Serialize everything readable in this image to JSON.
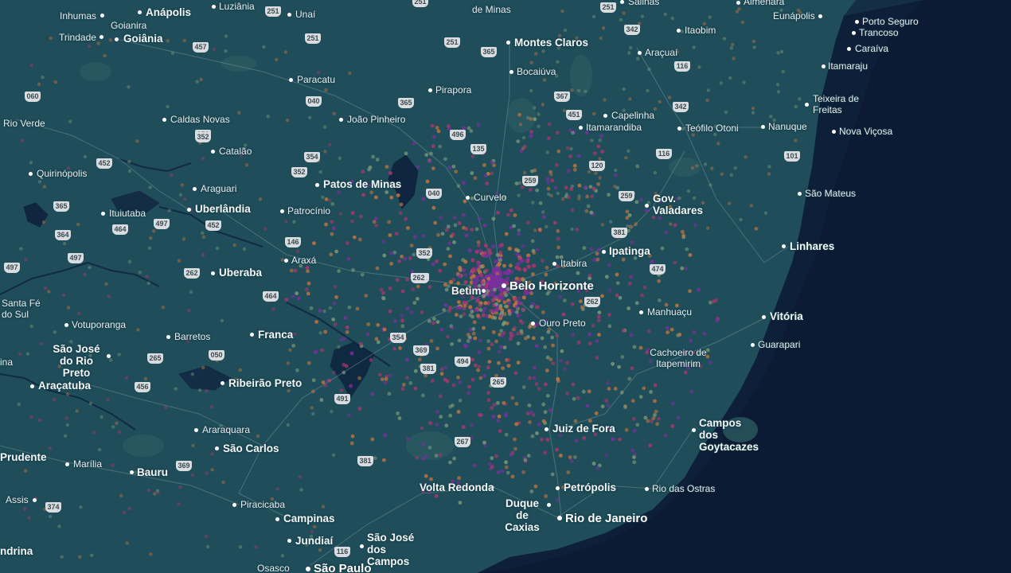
{
  "map": {
    "colors": {
      "land": "#1f4e5a",
      "ocean": "#0c1a33",
      "water_bodies": "#0f2540",
      "road": "#6f8d95",
      "point_purple": "#7a2f9e",
      "point_magenta": "#b0356e",
      "point_orange": "#c6763e",
      "point_sage": "#7f9a7a"
    },
    "cities": [
      {
        "id": "belo-horizonte",
        "name": "Belo Horizonte",
        "size": "mega"
      },
      {
        "id": "rio-de-janeiro",
        "name": "Rio de Janeiro",
        "size": "mega"
      },
      {
        "id": "sao-paulo",
        "name": "São Paulo",
        "size": "mega"
      },
      {
        "id": "goiania",
        "name": "Goiânia",
        "size": "major"
      },
      {
        "id": "anapolis",
        "name": "Anápolis",
        "size": "major"
      },
      {
        "id": "campinas",
        "name": "Campinas",
        "size": "major"
      },
      {
        "id": "uberlandia",
        "name": "Uberlândia",
        "size": "major"
      },
      {
        "id": "uberaba",
        "name": "Uberaba",
        "size": "major"
      },
      {
        "id": "montes-claros",
        "name": "Montes Claros",
        "size": "major"
      },
      {
        "id": "juiz-de-fora",
        "name": "Juiz de Fora",
        "size": "major"
      },
      {
        "id": "vitoria",
        "name": "Vitória",
        "size": "major"
      },
      {
        "id": "ipatinga",
        "name": "Ipatinga",
        "size": "major"
      },
      {
        "id": "gov-valadares",
        "name": "Gov. Valadares",
        "size": "major"
      },
      {
        "id": "patos-de-minas",
        "name": "Patos de Minas",
        "size": "major"
      },
      {
        "id": "ribeirao-preto",
        "name": "Ribeirão Preto",
        "size": "major"
      },
      {
        "id": "franca",
        "name": "Franca",
        "size": "major"
      },
      {
        "id": "bauru",
        "name": "Bauru",
        "size": "major"
      },
      {
        "id": "sao-carlos",
        "name": "São Carlos",
        "size": "major"
      },
      {
        "id": "petropolis",
        "name": "Petrópolis",
        "size": "major"
      },
      {
        "id": "volta-redonda",
        "name": "Volta Redonda",
        "size": "major"
      },
      {
        "id": "duque-de-caxias",
        "name": "Duque de Caxias",
        "size": "major"
      },
      {
        "id": "campos-dos-goytacazes",
        "name": "Campos dos Goytacazes",
        "size": "major"
      },
      {
        "id": "sao-jose-dos-campos",
        "name": "São José dos Campos",
        "size": "major"
      },
      {
        "id": "jundiai",
        "name": "Jundiaí",
        "size": "major"
      },
      {
        "id": "linhares",
        "name": "Linhares",
        "size": "major"
      },
      {
        "id": "betim",
        "name": "Betim",
        "size": "major"
      },
      {
        "id": "sao-jose-do-rio-preto",
        "name": "São José do Rio Preto",
        "size": "major"
      },
      {
        "id": "aracatuba",
        "name": "Araçatuba",
        "size": "major"
      },
      {
        "id": "presidente-prudente",
        "name": "Prudente",
        "size": "major"
      },
      {
        "id": "santa-fe-do-sul",
        "name": "Santa Fé do Sul",
        "size": "minor"
      },
      {
        "id": "inhumas",
        "name": "Inhumas",
        "size": "minor"
      },
      {
        "id": "goianira",
        "name": "Goianira",
        "size": "minor"
      },
      {
        "id": "trindade",
        "name": "Trindade",
        "size": "minor"
      },
      {
        "id": "luziania",
        "name": "Luziânia",
        "size": "minor"
      },
      {
        "id": "unai",
        "name": "Unaí",
        "size": "minor"
      },
      {
        "id": "paracatu",
        "name": "Paracatu",
        "size": "minor"
      },
      {
        "id": "joao-pinheiro",
        "name": "João Pinheiro",
        "size": "minor"
      },
      {
        "id": "rio-verde",
        "name": "Rio Verde",
        "size": "minor"
      },
      {
        "id": "caldas-novas",
        "name": "Caldas Novas",
        "size": "minor"
      },
      {
        "id": "catalao",
        "name": "Catalão",
        "size": "minor"
      },
      {
        "id": "quirinopolis",
        "name": "Quirinópolis",
        "size": "minor"
      },
      {
        "id": "araguari",
        "name": "Araguari",
        "size": "minor"
      },
      {
        "id": "ituiutaba",
        "name": "Ituiutaba",
        "size": "minor"
      },
      {
        "id": "patrocinio",
        "name": "Patrocínio",
        "size": "minor"
      },
      {
        "id": "araxa",
        "name": "Araxá",
        "size": "minor"
      },
      {
        "id": "votuporanga",
        "name": "Votuporanga",
        "size": "minor"
      },
      {
        "id": "barretos",
        "name": "Barretos",
        "size": "minor"
      },
      {
        "id": "araraquara",
        "name": "Araraquara",
        "size": "minor"
      },
      {
        "id": "marilia",
        "name": "Marília",
        "size": "minor"
      },
      {
        "id": "assis",
        "name": "Assis",
        "size": "minor"
      },
      {
        "id": "piracicaba",
        "name": "Piracicaba",
        "size": "minor"
      },
      {
        "id": "osasco",
        "name": "Osasco",
        "size": "minor"
      },
      {
        "id": "andradina",
        "name": "ndrina",
        "size": "minor"
      },
      {
        "id": "ilha-solteira",
        "name": "ina",
        "size": "minor"
      },
      {
        "id": "pirapora",
        "name": "Pirapora",
        "size": "minor"
      },
      {
        "id": "bocaiuva",
        "name": "Bocaiúva",
        "size": "minor"
      },
      {
        "id": "curvelo",
        "name": "Curvelo",
        "size": "minor"
      },
      {
        "id": "itabira",
        "name": "Itabira",
        "size": "minor"
      },
      {
        "id": "ouro-preto",
        "name": "Ouro Preto",
        "size": "minor"
      },
      {
        "id": "manhuacu",
        "name": "Manhuaçu",
        "size": "minor"
      },
      {
        "id": "cachoeiro-de-itapemirim",
        "name": "Cachoeiro de Itapemirim",
        "size": "minor"
      },
      {
        "id": "guarapari",
        "name": "Guarapari",
        "size": "minor"
      },
      {
        "id": "sao-mateus",
        "name": "São Mateus",
        "size": "minor"
      },
      {
        "id": "nanuque",
        "name": "Nanuque",
        "size": "minor"
      },
      {
        "id": "teofilo-otoni",
        "name": "Teófilo Otoni",
        "size": "minor"
      },
      {
        "id": "capelinha",
        "name": "Capelinha",
        "size": "minor"
      },
      {
        "id": "itamarandiba",
        "name": "Itamarandiba",
        "size": "minor"
      },
      {
        "id": "aracuai",
        "name": "Araçuaí",
        "size": "minor"
      },
      {
        "id": "itaobim",
        "name": "Itaobim",
        "size": "minor"
      },
      {
        "id": "eunapolis",
        "name": "Eunápolis",
        "size": "minor"
      },
      {
        "id": "porto-seguro",
        "name": "Porto Seguro",
        "size": "minor"
      },
      {
        "id": "trancoso",
        "name": "Trancoso",
        "size": "minor"
      },
      {
        "id": "caraiva",
        "name": "Caraíva",
        "size": "minor"
      },
      {
        "id": "itamaraju",
        "name": "Itamaraju",
        "size": "minor"
      },
      {
        "id": "teixeira-de-freitas",
        "name": "Teixeira de Freitas",
        "size": "minor"
      },
      {
        "id": "nova-vicosa",
        "name": "Nova Viçosa",
        "size": "minor"
      },
      {
        "id": "rio-das-ostras",
        "name": "Rio das Ostras",
        "size": "minor"
      },
      {
        "id": "almenara",
        "name": "Almenara",
        "size": "minor"
      },
      {
        "id": "salinas",
        "name": "Salinas",
        "size": "minor"
      },
      {
        "id": "de-minas",
        "name": "de Minas",
        "size": "minor"
      }
    ],
    "shields": [
      "251",
      "251",
      "251",
      "251",
      "251",
      "457",
      "060",
      "352",
      "452",
      "365",
      "364",
      "497",
      "497",
      "464",
      "262",
      "464",
      "262",
      "497",
      "452",
      "040",
      "365",
      "352",
      "354",
      "352",
      "146",
      "352",
      "262",
      "354",
      "369",
      "381",
      "491",
      "494",
      "265",
      "267",
      "381",
      "369",
      "374",
      "456",
      "265",
      "050",
      "116",
      "342",
      "342",
      "116",
      "116",
      "101",
      "365",
      "496",
      "135",
      "040",
      "367",
      "451",
      "120",
      "259",
      "259",
      "381",
      "474",
      "262"
    ]
  }
}
